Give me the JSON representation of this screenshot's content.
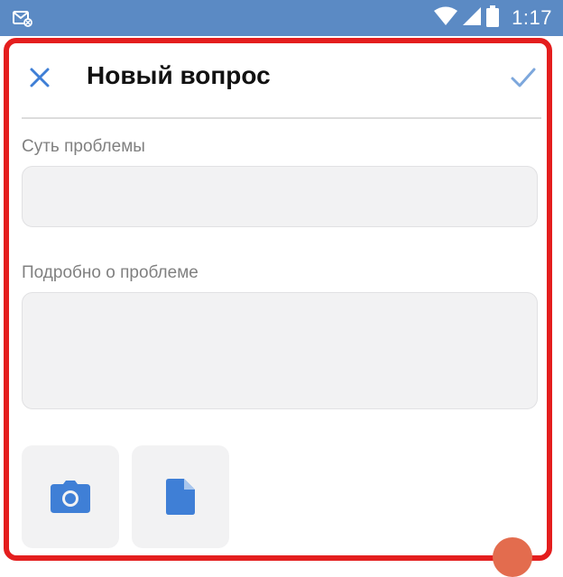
{
  "status_bar": {
    "time": "1:17",
    "icons": [
      "notification-icon",
      "wifi-icon",
      "signal-icon",
      "battery-icon"
    ]
  },
  "header": {
    "title": "Новый вопрос",
    "close_icon": "close-icon",
    "confirm_icon": "check-icon"
  },
  "form": {
    "summary_label": "Суть проблемы",
    "summary_value": "",
    "details_label": "Подробно о проблеме",
    "details_value": ""
  },
  "attachments": [
    {
      "icon": "camera-icon"
    },
    {
      "icon": "document-icon"
    }
  ],
  "colors": {
    "status_bar": "#5b8ac4",
    "accent": "#3f7fd6",
    "highlight_frame": "#e41e1e",
    "field_bg": "#f2f2f3"
  }
}
